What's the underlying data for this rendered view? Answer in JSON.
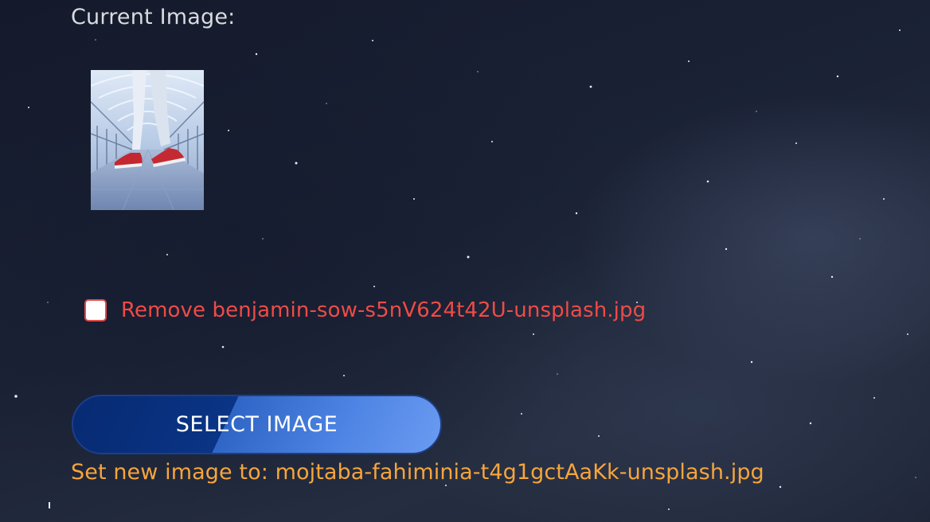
{
  "form": {
    "current_image_label": "Current Image:",
    "current_image_alt": "benjamin-sow-s5nV624t42U-unsplash.jpg",
    "remove_label": "Remove benjamin-sow-s5nV624t42U-unsplash.jpg",
    "remove_checked": false,
    "select_button_label": "SELECT IMAGE",
    "new_image_prefix": "Set new image to: ",
    "new_image_filename": "mojtaba-fahiminia-t4g1gctAaKk-unsplash.jpg"
  },
  "colors": {
    "background": "#1b2236",
    "label_text": "#d9dbe0",
    "remove_text": "#ef4b46",
    "button_dark": "#0a3485",
    "button_light": "#6b9bf2",
    "new_image_text": "#f6a53c"
  }
}
